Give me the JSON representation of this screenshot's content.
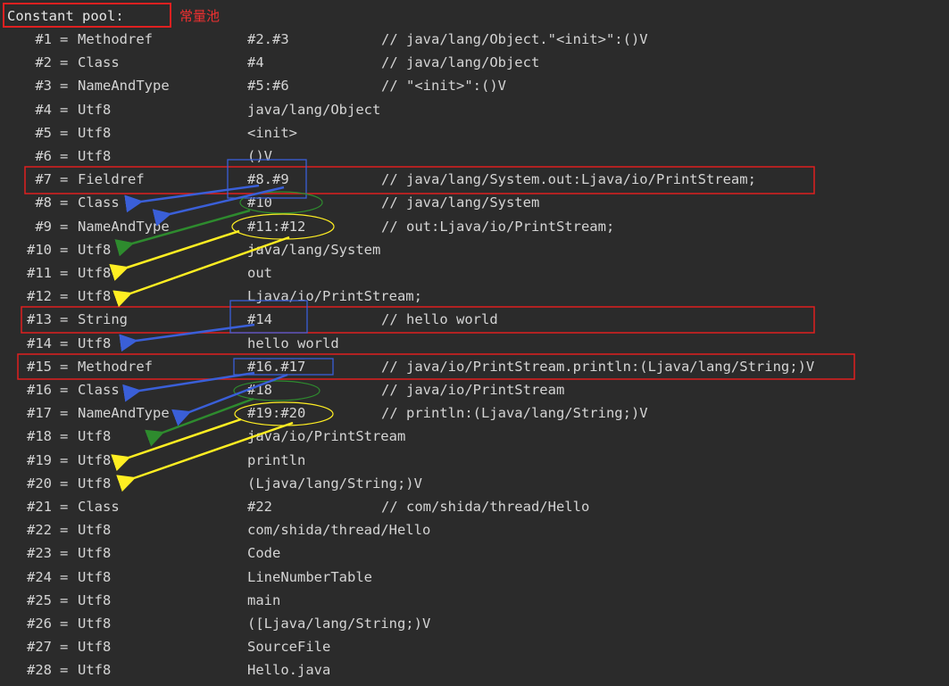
{
  "header": {
    "title": "Constant pool:",
    "note": "常量池"
  },
  "entries": [
    {
      "idx": "#1",
      "type": "Methodref",
      "value": "#2.#3",
      "comment": "// java/lang/Object.\"<init>\":()V"
    },
    {
      "idx": "#2",
      "type": "Class",
      "value": "#4",
      "comment": "// java/lang/Object"
    },
    {
      "idx": "#3",
      "type": "NameAndType",
      "value": "#5:#6",
      "comment": "// \"<init>\":()V"
    },
    {
      "idx": "#4",
      "type": "Utf8",
      "value": "java/lang/Object",
      "comment": ""
    },
    {
      "idx": "#5",
      "type": "Utf8",
      "value": "<init>",
      "comment": ""
    },
    {
      "idx": "#6",
      "type": "Utf8",
      "value": "()V",
      "comment": ""
    },
    {
      "idx": "#7",
      "type": "Fieldref",
      "value": "#8.#9",
      "comment": "// java/lang/System.out:Ljava/io/PrintStream;"
    },
    {
      "idx": "#8",
      "type": "Class",
      "value": "#10",
      "comment": "// java/lang/System"
    },
    {
      "idx": "#9",
      "type": "NameAndType",
      "value": "#11:#12",
      "comment": "// out:Ljava/io/PrintStream;"
    },
    {
      "idx": "#10",
      "type": "Utf8",
      "value": "java/lang/System",
      "comment": ""
    },
    {
      "idx": "#11",
      "type": "Utf8",
      "value": "out",
      "comment": ""
    },
    {
      "idx": "#12",
      "type": "Utf8",
      "value": "Ljava/io/PrintStream;",
      "comment": ""
    },
    {
      "idx": "#13",
      "type": "String",
      "value": "#14",
      "comment": "// hello world"
    },
    {
      "idx": "#14",
      "type": "Utf8",
      "value": "hello world",
      "comment": ""
    },
    {
      "idx": "#15",
      "type": "Methodref",
      "value": "#16.#17",
      "comment": "// java/io/PrintStream.println:(Ljava/lang/String;)V"
    },
    {
      "idx": "#16",
      "type": "Class",
      "value": "#18",
      "comment": "// java/io/PrintStream"
    },
    {
      "idx": "#17",
      "type": "NameAndType",
      "value": "#19:#20",
      "comment": "// println:(Ljava/lang/String;)V"
    },
    {
      "idx": "#18",
      "type": "Utf8",
      "value": "java/io/PrintStream",
      "comment": ""
    },
    {
      "idx": "#19",
      "type": "Utf8",
      "value": "println",
      "comment": ""
    },
    {
      "idx": "#20",
      "type": "Utf8",
      "value": "(Ljava/lang/String;)V",
      "comment": ""
    },
    {
      "idx": "#21",
      "type": "Class",
      "value": "#22",
      "comment": "// com/shida/thread/Hello"
    },
    {
      "idx": "#22",
      "type": "Utf8",
      "value": "com/shida/thread/Hello",
      "comment": ""
    },
    {
      "idx": "#23",
      "type": "Utf8",
      "value": "Code",
      "comment": ""
    },
    {
      "idx": "#24",
      "type": "Utf8",
      "value": "LineNumberTable",
      "comment": ""
    },
    {
      "idx": "#25",
      "type": "Utf8",
      "value": "main",
      "comment": ""
    },
    {
      "idx": "#26",
      "type": "Utf8",
      "value": "([Ljava/lang/String;)V",
      "comment": ""
    },
    {
      "idx": "#27",
      "type": "Utf8",
      "value": "SourceFile",
      "comment": ""
    },
    {
      "idx": "#28",
      "type": "Utf8",
      "value": "Hello.java",
      "comment": ""
    }
  ],
  "colors": {
    "background": "#2b2b2b",
    "text": "#d4d4d4",
    "highlight_red": "#e02020",
    "highlight_blue": "#3a5fd8",
    "highlight_green": "#2e8b2e",
    "highlight_yellow": "#ffee22"
  }
}
